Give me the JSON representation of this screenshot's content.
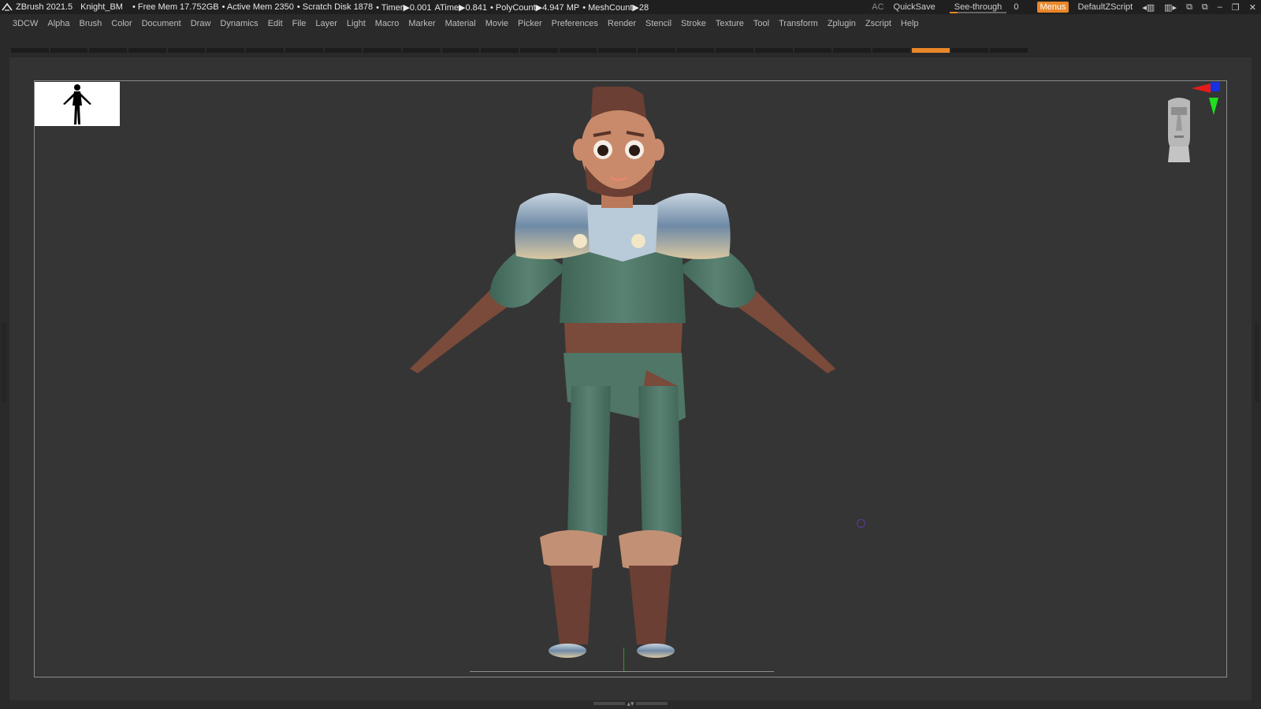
{
  "app": {
    "name": "ZBrush 2021.5",
    "document": "Knight_BM"
  },
  "stats": {
    "free_mem": "• Free Mem 17.752GB",
    "active_mem": "• Active Mem 2350",
    "scratch_disk": "• Scratch Disk 1878",
    "timer": "• Timer▶0.001",
    "atime": "ATime▶0.841",
    "polycount": "• PolyCount▶4.947 MP",
    "meshcount": "• MeshCount▶28"
  },
  "top_right": {
    "ac": "AC",
    "quicksave": "QuickSave",
    "see_through_label": "See-through",
    "see_through_value": "0",
    "see_through_fraction": 0,
    "menus": "Menus",
    "default_script": "DefaultZScript"
  },
  "menu": {
    "items": [
      "3DCW",
      "Alpha",
      "Brush",
      "Color",
      "Document",
      "Draw",
      "Dynamics",
      "Edit",
      "File",
      "Layer",
      "Light",
      "Macro",
      "Marker",
      "Material",
      "Movie",
      "Picker",
      "Preferences",
      "Render",
      "Stencil",
      "Stroke",
      "Texture",
      "Tool",
      "Transform",
      "Zplugin",
      "Zscript",
      "Help"
    ]
  },
  "shelf": {
    "count": 26,
    "active_index": 23
  },
  "icons": {
    "logo": "zbrush-logo-icon",
    "thumbnail": "figure-silhouette-icon",
    "axes": "axis-gizmo-icon",
    "navhead": "navigation-head-icon",
    "minimize": "minimize-icon",
    "restore": "restore-icon",
    "close": "close-icon"
  },
  "colors": {
    "accent": "#e8872a",
    "background": "#2a2a2a",
    "canvas": "#353535",
    "cloth": "#4d7464",
    "leather": "#7a4a3b",
    "skin": "#b9795a",
    "metal": "#9fb1c4"
  }
}
